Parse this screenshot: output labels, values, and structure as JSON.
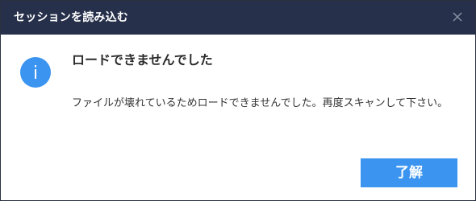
{
  "window": {
    "title": "セッションを読み込む",
    "close_icon": "close-icon"
  },
  "dialog": {
    "icon": "info-icon",
    "icon_glyph": "i",
    "heading": "ロードできませんでした",
    "message": "ファイルが壊れているためロードできませんでした。再度スキャンして下さい。"
  },
  "buttons": {
    "ok_label": "了解"
  },
  "colors": {
    "titlebar_bg": "#26304a",
    "accent": "#3a94f0",
    "icon_circle": "#3a94f0"
  }
}
